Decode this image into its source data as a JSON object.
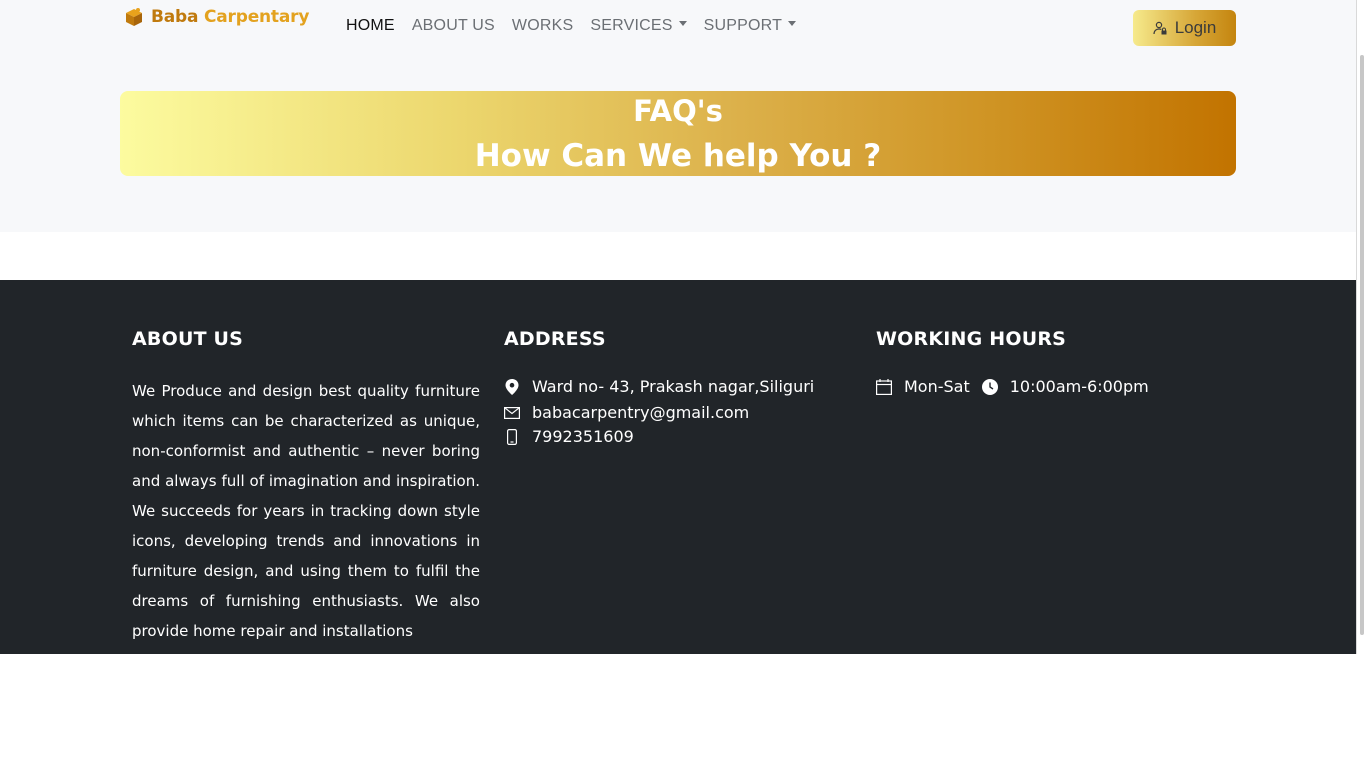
{
  "brand": {
    "part1": "Baba",
    "part2": "Carpentary"
  },
  "nav": {
    "home": "HOME",
    "about": "ABOUT US",
    "works": "WORKS",
    "services": "SERVICES",
    "support": "SUPPORT"
  },
  "login": {
    "label": "Login"
  },
  "hero": {
    "title": "FAQ's",
    "subtitle": "How Can We help You ?"
  },
  "footer": {
    "about": {
      "title": "ABOUT US",
      "text": "We Produce and design best quality furniture which items can be characterized as unique, non-conformist and authentic – never boring and always full of imagination and inspiration. We succeeds for years in tracking down style icons, developing trends and innovations in furniture design, and using them to fulfil the dreams of furnishing enthusiasts. We also provide home repair and installations"
    },
    "address": {
      "title": "ADDRESS",
      "location": "Ward no- 43, Prakash nagar,Siliguri",
      "email": "babacarpentry@gmail.com",
      "phone": "7992351609"
    },
    "hours": {
      "title": "WORKING HOURS",
      "days": "Mon-Sat",
      "time": "10:00am-6:00pm"
    }
  },
  "colors": {
    "brand_dark": "#c07a0e",
    "brand_light": "#e3a21f",
    "footer_bg": "#212529",
    "hero_start": "#fcfb9f",
    "hero_end": "#c27300"
  }
}
